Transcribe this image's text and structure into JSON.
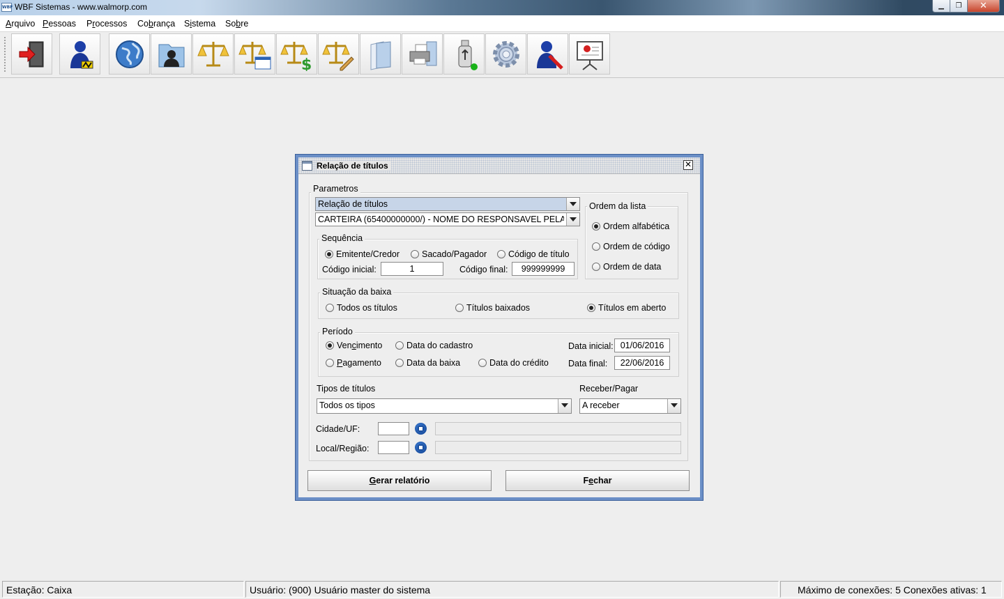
{
  "window": {
    "title": "WBF Sistemas - www.walmorp.com",
    "app_icon_text": "WBF"
  },
  "menu": [
    {
      "prefix": "",
      "mnemonic": "A",
      "rest": "rquivo"
    },
    {
      "prefix": "",
      "mnemonic": "P",
      "rest": "essoas"
    },
    {
      "prefix": "P",
      "mnemonic": "r",
      "rest": "ocessos"
    },
    {
      "prefix": "Co",
      "mnemonic": "b",
      "rest": "rança"
    },
    {
      "prefix": "S",
      "mnemonic": "i",
      "rest": "stema"
    },
    {
      "prefix": "So",
      "mnemonic": "b",
      "rest": "re"
    }
  ],
  "toolbar": {
    "icons": [
      "exit-door-icon",
      "user-person-icon",
      "globe-icon",
      "contact-card-icon",
      "scales-icon",
      "scales-window-icon",
      "scales-money-icon",
      "scales-edit-icon",
      "documents-icon",
      "printer-icon",
      "usb-drive-icon",
      "settings-gear-icon",
      "user-tools-icon",
      "presentation-board-icon"
    ]
  },
  "dialog": {
    "title": "Relação de títulos",
    "parametros": {
      "legend": "Parametros",
      "report_type": "Relação de títulos",
      "carteira": "CARTEIRA (65400000000/) - NOME DO RESPONSAVEL PELA ..."
    },
    "sequencia": {
      "legend": "Sequência",
      "options": [
        "Emitente/Credor",
        "Sacado/Pagador",
        "Código de título"
      ],
      "selected": "Emitente/Credor",
      "codigo_inicial_label": "Código inicial:",
      "codigo_inicial": "1",
      "codigo_final_label": "Código final:",
      "codigo_final": "999999999"
    },
    "ordem": {
      "legend": "Ordem da lista",
      "options": [
        "Ordem alfabética",
        "Ordem de código",
        "Ordem de data"
      ],
      "selected": "Ordem alfabética"
    },
    "situacao": {
      "legend": "Situação da baixa",
      "options": [
        "Todos os títulos",
        "Títulos baixados",
        "Títulos em aberto"
      ],
      "selected": "Títulos em aberto"
    },
    "periodo": {
      "legend": "Período",
      "vencimento": {
        "prefix": "Ven",
        "mnemonic": "c",
        "rest": "imento"
      },
      "data_cadastro": "Data do cadastro",
      "pagamento": {
        "prefix": "",
        "mnemonic": "P",
        "rest": "agamento"
      },
      "data_baixa": "Data da baixa",
      "data_credito": "Data do crédito",
      "selected": "Vencimento",
      "data_inicial_label": "Data inicial:",
      "data_inicial": "01/06/2016",
      "data_final_label": "Data final:",
      "data_final": "22/06/2016"
    },
    "tipos": {
      "label": "Tipos de títulos",
      "value": "Todos os tipos"
    },
    "receber_pagar": {
      "label": "Receber/Pagar",
      "value": "A receber"
    },
    "cidade_label": "Cidade/UF:",
    "local_label": "Local/Região:",
    "buttons": {
      "gerar": {
        "prefix": "",
        "mnemonic": "G",
        "rest": "erar relatório"
      },
      "fechar": {
        "prefix": "F",
        "mnemonic": "e",
        "rest": "char"
      }
    }
  },
  "status": {
    "estacao": "Estação: Caixa",
    "usuario": "Usuário: (900) Usuário master do sistema",
    "conexoes": "Máximo de conexões: 5 Conexões ativas: 1"
  }
}
